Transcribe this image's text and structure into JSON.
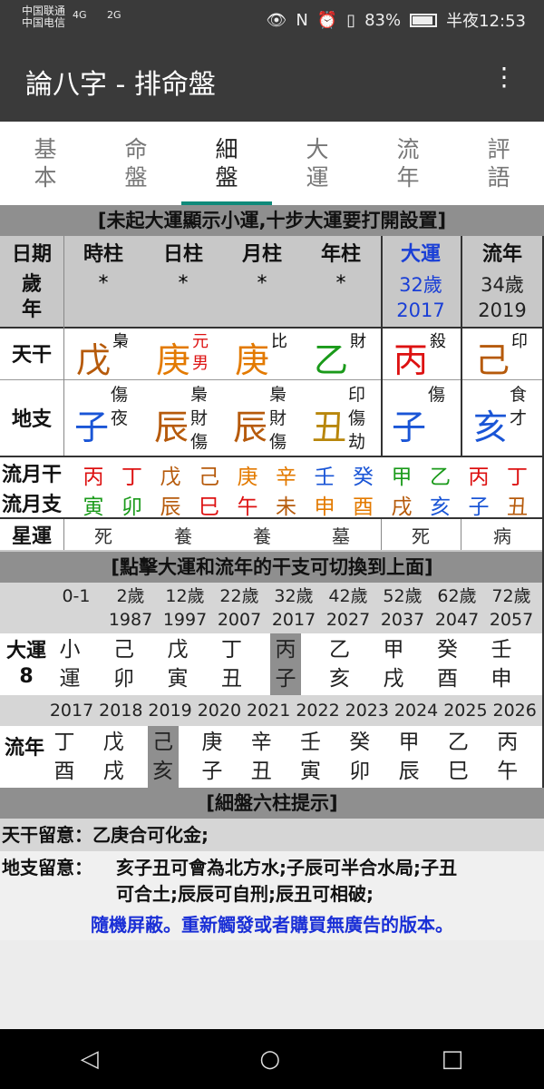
{
  "status": {
    "carrier1": "中国联通",
    "carrier2": "中国电信",
    "net1": "4G",
    "net2": "2G",
    "battery": "83%",
    "time": "半夜12:53"
  },
  "appbar": {
    "title": "論八字 - 排命盤",
    "menu_icon": "⋮"
  },
  "tabs": [
    {
      "l1": "基",
      "l2": "本"
    },
    {
      "l1": "命",
      "l2": "盤"
    },
    {
      "l1": "細",
      "l2": "盤"
    },
    {
      "l1": "大",
      "l2": "運"
    },
    {
      "l1": "流",
      "l2": "年"
    },
    {
      "l1": "評",
      "l2": "語"
    }
  ],
  "banner1": "[未起大運顯示小運,十步大運要打開設置]",
  "header": [
    "日期",
    "時柱",
    "日柱",
    "月柱",
    "年柱",
    "大運",
    "流年"
  ],
  "age": {
    "label1": "歲",
    "label2": "年",
    "shi": "*",
    "ri": "*",
    "yue": "*",
    "nian": "*",
    "dayun_age": "32歲",
    "dayun_year": "2017",
    "liunian_age": "34歲",
    "liunian_year": "2019"
  },
  "tiangan": {
    "label": "天干",
    "cells": [
      {
        "char": "戊",
        "sup": "梟",
        "color": "#b65a0b",
        "supColor": "#111"
      },
      {
        "char": "庚",
        "sup": "元",
        "sup2": "男",
        "color": "#e37a00",
        "supColor": "#d11"
      },
      {
        "char": "庚",
        "sup": "比",
        "color": "#e37a00",
        "supColor": "#111"
      },
      {
        "char": "乙",
        "sup": "財",
        "color": "#1a9a1a",
        "supColor": "#111"
      },
      {
        "char": "丙",
        "sup": "殺",
        "color": "#d11",
        "supColor": "#111"
      },
      {
        "char": "己",
        "sup": "印",
        "color": "#b65a0b",
        "supColor": "#111"
      }
    ]
  },
  "dizhi": {
    "label": "地支",
    "cells": [
      {
        "char": "子",
        "h1": "傷",
        "h2": "夜",
        "color": "#1a55d6"
      },
      {
        "char": "辰",
        "h1": "梟",
        "h2": "財",
        "h3": "傷",
        "color": "#b65a0b"
      },
      {
        "char": "辰",
        "h1": "梟",
        "h2": "財",
        "h3": "傷",
        "color": "#b65a0b"
      },
      {
        "char": "丑",
        "h1": "印",
        "h2": "傷",
        "h3": "劫",
        "color": "#b8860b"
      },
      {
        "char": "子",
        "h1": "傷",
        "color": "#1a55d6"
      },
      {
        "char": "亥",
        "h1": "食",
        "h2": "才",
        "color": "#1a55d6"
      }
    ]
  },
  "liuyuegan": {
    "label": "流月干",
    "items": [
      {
        "c": "丙",
        "col": "#d11"
      },
      {
        "c": "丁",
        "col": "#d11"
      },
      {
        "c": "戊",
        "col": "#b65a0b"
      },
      {
        "c": "己",
        "col": "#b65a0b"
      },
      {
        "c": "庚",
        "col": "#e37a00"
      },
      {
        "c": "辛",
        "col": "#e37a00"
      },
      {
        "c": "壬",
        "col": "#1a55d6"
      },
      {
        "c": "癸",
        "col": "#1a55d6"
      },
      {
        "c": "甲",
        "col": "#1a9a1a"
      },
      {
        "c": "乙",
        "col": "#1a9a1a"
      },
      {
        "c": "丙",
        "col": "#d11"
      },
      {
        "c": "丁",
        "col": "#d11"
      }
    ]
  },
  "liuyuezhi": {
    "label": "流月支",
    "items": [
      {
        "c": "寅",
        "col": "#1a9a1a"
      },
      {
        "c": "卯",
        "col": "#1a9a1a"
      },
      {
        "c": "辰",
        "col": "#b65a0b"
      },
      {
        "c": "巳",
        "col": "#d11"
      },
      {
        "c": "午",
        "col": "#d11"
      },
      {
        "c": "未",
        "col": "#b65a0b"
      },
      {
        "c": "申",
        "col": "#e37a00"
      },
      {
        "c": "酉",
        "col": "#e37a00"
      },
      {
        "c": "戌",
        "col": "#b65a0b"
      },
      {
        "c": "亥",
        "col": "#1a55d6"
      },
      {
        "c": "子",
        "col": "#1a55d6"
      },
      {
        "c": "丑",
        "col": "#b65a0b"
      }
    ]
  },
  "xingyun": {
    "label": "星運",
    "cells": [
      "死",
      "養",
      "養",
      "墓",
      "死",
      "病"
    ]
  },
  "banner2": "[點擊大運和流年的干支可切換到上面]",
  "dayun_ages": [
    {
      "a": "0-1",
      "y": ""
    },
    {
      "a": "2歲",
      "y": "1987"
    },
    {
      "a": "12歲",
      "y": "1997"
    },
    {
      "a": "22歲",
      "y": "2007"
    },
    {
      "a": "32歲",
      "y": "2017"
    },
    {
      "a": "42歲",
      "y": "2027"
    },
    {
      "a": "52歲",
      "y": "2037"
    },
    {
      "a": "62歲",
      "y": "2047"
    },
    {
      "a": "72歲",
      "y": "2057"
    }
  ],
  "dayun": {
    "label1": "大運",
    "label2": "8",
    "items": [
      {
        "t": "小",
        "b": "運"
      },
      {
        "t": "己",
        "b": "卯"
      },
      {
        "t": "戊",
        "b": "寅"
      },
      {
        "t": "丁",
        "b": "丑"
      },
      {
        "t": "丙",
        "b": "子",
        "sel": true
      },
      {
        "t": "乙",
        "b": "亥"
      },
      {
        "t": "甲",
        "b": "戌"
      },
      {
        "t": "癸",
        "b": "酉"
      },
      {
        "t": "壬",
        "b": "申"
      }
    ]
  },
  "liunian_years": [
    "2017",
    "2018",
    "2019",
    "2020",
    "2021",
    "2022",
    "2023",
    "2024",
    "2025",
    "2026"
  ],
  "liunian": {
    "label": "流年",
    "items": [
      {
        "t": "丁",
        "b": "酉"
      },
      {
        "t": "戊",
        "b": "戌"
      },
      {
        "t": "己",
        "b": "亥",
        "sel": true
      },
      {
        "t": "庚",
        "b": "子"
      },
      {
        "t": "辛",
        "b": "丑"
      },
      {
        "t": "壬",
        "b": "寅"
      },
      {
        "t": "癸",
        "b": "卯"
      },
      {
        "t": "甲",
        "b": "辰"
      },
      {
        "t": "乙",
        "b": "巳"
      },
      {
        "t": "丙",
        "b": "午"
      }
    ]
  },
  "banner3": "[細盤六柱提示]",
  "notes": {
    "tg_label": "天干留意：",
    "tg_text": "乙庚合可化金;",
    "dz_label": "地支留意：",
    "dz_text1": "亥子丑可會為北方水;子辰可半合水局;子丑",
    "dz_text2": "可合土;辰辰可自刑;辰丑可相破;"
  },
  "ad_text": "隨機屏蔽。重新觸發或者購買無廣告的版本。",
  "nav": {
    "back": "◁",
    "home": "○",
    "recent": "□"
  }
}
